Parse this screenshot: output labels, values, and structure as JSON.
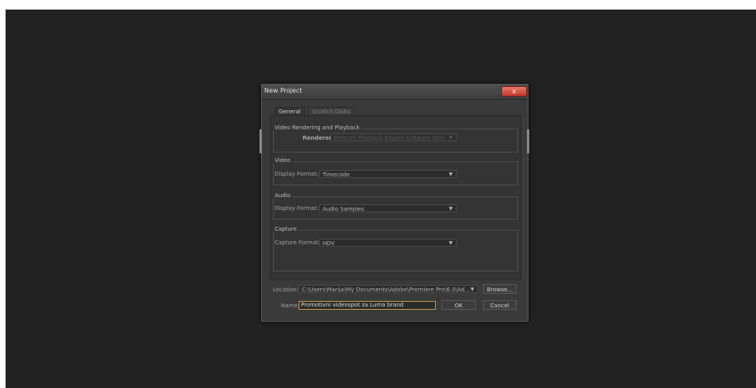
{
  "dialog": {
    "title": "New Project",
    "close_glyph": "x"
  },
  "tabs": [
    "General",
    "Scratch Disks"
  ],
  "video_rendering": {
    "group_label": "Video Rendering and Playback",
    "renderer_label": "Renderer:",
    "renderer_value": "Mercury Playback Engine Software Only"
  },
  "video": {
    "group_label": "Video",
    "display_format_label": "Display Format:",
    "display_format_value": "Timecode"
  },
  "audio": {
    "group_label": "Audio",
    "display_format_label": "Display Format:",
    "display_format_value": "Audio Samples"
  },
  "capture": {
    "group_label": "Capture",
    "capture_format_label": "Capture Format:",
    "capture_format_value": "HDV"
  },
  "location": {
    "label": "Location:",
    "value": "C:\\Users\\Marija\\My Documents\\Adobe\\Premiere Pro\\6.0\\Ad...",
    "browse_label": "Browse..."
  },
  "name": {
    "label": "Name:",
    "value": "Promotivni videospot za Luma brand"
  },
  "buttons": {
    "ok": "OK",
    "cancel": "Cancel"
  },
  "colors": {
    "screen_bg": "#222222",
    "dialog_bg": "#3a3a3a",
    "close_red": "#c2392a",
    "focus_border": "#c49a37"
  },
  "icons": {
    "dropdown": "chevron-down-icon",
    "close": "close-icon"
  }
}
